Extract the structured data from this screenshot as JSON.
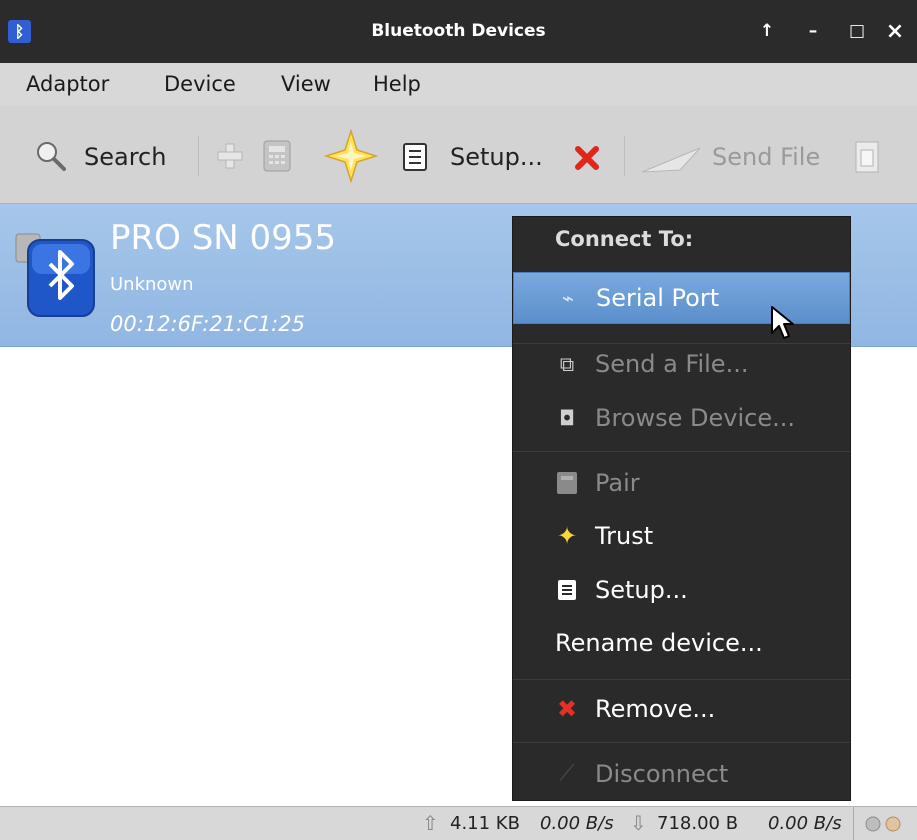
{
  "window": {
    "title": "Bluetooth Devices",
    "controls": {
      "up": "↑",
      "minimize": "–",
      "maximize": "□",
      "close": "×"
    },
    "colors": {
      "titlebar": "#2b2b2b",
      "selection": "#9bbfe7",
      "accent": "#2f5fd0"
    }
  },
  "menubar": {
    "items": [
      "Adaptor",
      "Device",
      "View",
      "Help"
    ]
  },
  "toolbar": {
    "search_label": "Search",
    "setup_label": "Setup...",
    "send_file_label": "Send File",
    "icons": [
      "search-icon",
      "add-icon",
      "pair-icon",
      "trust-icon",
      "setup-icon",
      "remove-icon",
      "send-file-icon",
      "browse-icon"
    ]
  },
  "device": {
    "name": "PRO SN 0955",
    "class": "Unknown",
    "address": "00:12:6F:21:C1:25"
  },
  "context_menu": {
    "header": "Connect To:",
    "items": {
      "serial_port": "Serial Port",
      "send_file": "Send a File...",
      "browse": "Browse Device...",
      "pair": "Pair",
      "trust": "Trust",
      "setup": "Setup...",
      "rename": "Rename device...",
      "remove": "Remove...",
      "disconnect": "Disconnect"
    }
  },
  "statusbar": {
    "up_total": "4.11 KB",
    "up_rate": "0.00 B/s",
    "down_total": "718.00 B",
    "down_rate": "0.00 B/s"
  }
}
